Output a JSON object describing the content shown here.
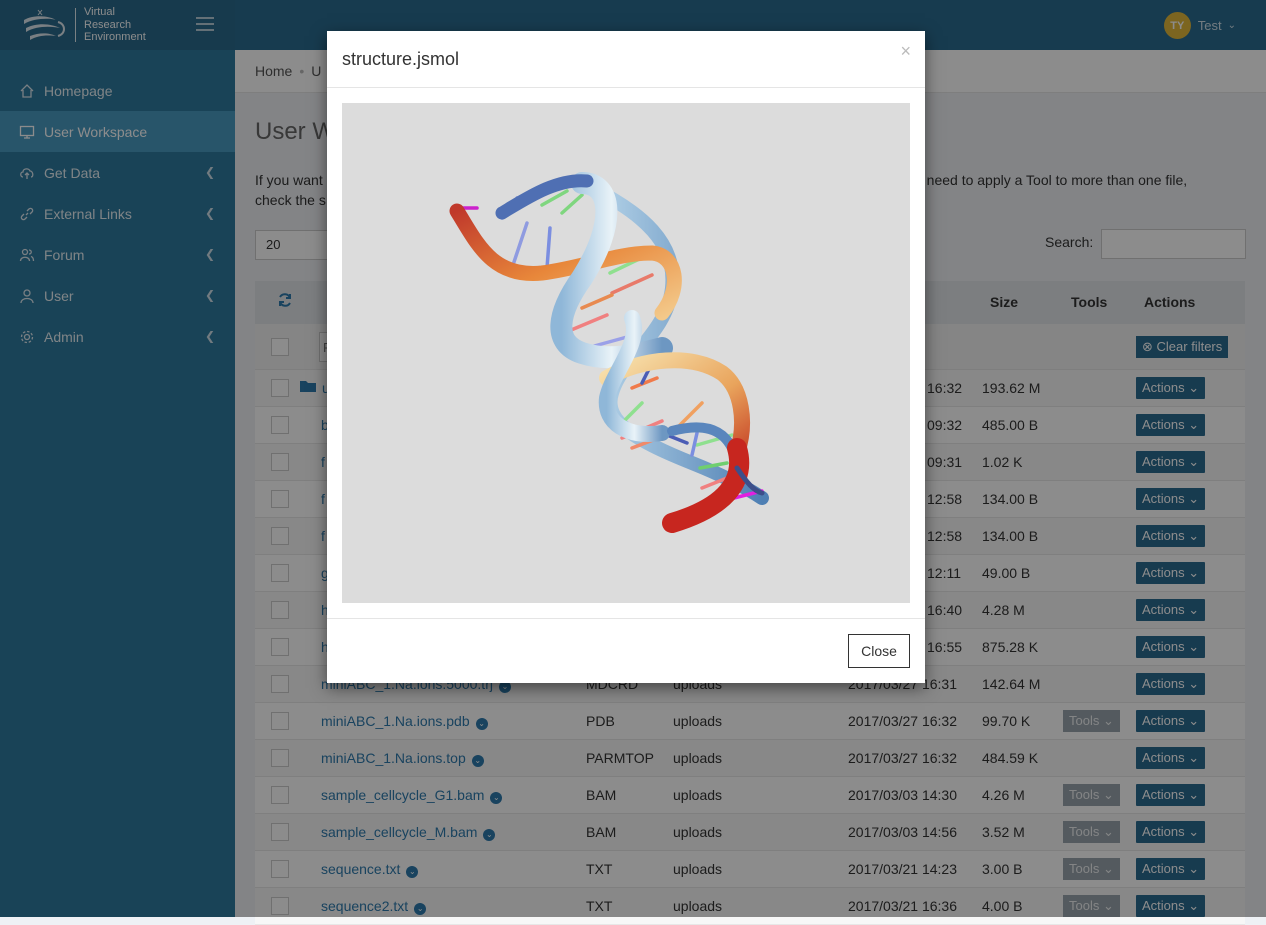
{
  "header": {
    "logo_lines": [
      "Virtual",
      "Research",
      "Environment"
    ],
    "user_initials": "TY",
    "user_name": "Test"
  },
  "sidebar": {
    "items": [
      {
        "label": "Homepage",
        "icon": "home-icon"
      },
      {
        "label": "User Workspace",
        "icon": "monitor-icon",
        "active": true
      },
      {
        "label": "Get Data",
        "icon": "cloud-upload-icon"
      },
      {
        "label": "External Links",
        "icon": "link-icon"
      },
      {
        "label": "Forum",
        "icon": "users-icon"
      },
      {
        "label": "User",
        "icon": "user-icon"
      },
      {
        "label": "Admin",
        "icon": "gear-icon"
      }
    ]
  },
  "breadcrumb": [
    "Home",
    "U"
  ],
  "page": {
    "title": "User W",
    "intro_left": "If you want",
    "intro_right": "u need to apply a Tool to more than one file,",
    "intro_line2": "check the s",
    "length_value": "20",
    "search_label": "Search:"
  },
  "table": {
    "headers": {
      "size": "Size",
      "tools": "Tools",
      "actions": "Actions"
    },
    "filter_input": "F",
    "clear_filters": "Clear filters",
    "actions_label": "Actions",
    "tools_label": "Tools",
    "rows": [
      {
        "name": "u",
        "type": "",
        "project": "",
        "date": "16:32",
        "size": "193.62 M",
        "folder": true,
        "tools": false
      },
      {
        "name": "b",
        "type": "",
        "project": "",
        "date": "09:32",
        "size": "485.00 B",
        "tools": false
      },
      {
        "name": "f",
        "type": "",
        "project": "",
        "date": "09:31",
        "size": "1.02 K",
        "tools": false
      },
      {
        "name": "f",
        "type": "",
        "project": "",
        "date": "12:58",
        "size": "134.00 B",
        "tools": false
      },
      {
        "name": "f",
        "type": "",
        "project": "",
        "date": "12:58",
        "size": "134.00 B",
        "tools": false
      },
      {
        "name": "g",
        "type": "",
        "project": "",
        "date": "12:11",
        "size": "49.00 B",
        "tools": false
      },
      {
        "name": "h",
        "type": "",
        "project": "",
        "date": "16:40",
        "size": "4.28 M",
        "tools": false
      },
      {
        "name": "h",
        "type": "",
        "project": "",
        "date": "16:55",
        "size": "875.28 K",
        "tools": false
      },
      {
        "name": "miniABC_1.Na.ions.5000.trj",
        "type": "MDCRD",
        "project": "uploads",
        "date": "2017/03/27 16:31",
        "size": "142.64 M",
        "tools": false
      },
      {
        "name": "miniABC_1.Na.ions.pdb",
        "type": "PDB",
        "project": "uploads",
        "date": "2017/03/27 16:32",
        "size": "99.70 K",
        "tools": true
      },
      {
        "name": "miniABC_1.Na.ions.top",
        "type": "PARMTOP",
        "project": "uploads",
        "date": "2017/03/27 16:32",
        "size": "484.59 K",
        "tools": false
      },
      {
        "name": "sample_cellcycle_G1.bam",
        "type": "BAM",
        "project": "uploads",
        "date": "2017/03/03 14:30",
        "size": "4.26 M",
        "tools": true
      },
      {
        "name": "sample_cellcycle_M.bam",
        "type": "BAM",
        "project": "uploads",
        "date": "2017/03/03 14:56",
        "size": "3.52 M",
        "tools": true
      },
      {
        "name": "sequence.txt",
        "type": "TXT",
        "project": "uploads",
        "date": "2017/03/21 14:23",
        "size": "3.00 B",
        "tools": true
      },
      {
        "name": "sequence2.txt",
        "type": "TXT",
        "project": "uploads",
        "date": "2017/03/21 16:36",
        "size": "4.00 B",
        "tools": true
      }
    ]
  },
  "modal": {
    "title": "structure.jsmol",
    "close_label": "Close",
    "x_label": "×"
  },
  "colors": {
    "header": "#2b6c90",
    "sidebar": "#2e7a9f",
    "sidebar_active": "#4a9bc2",
    "button": "#2b6c90",
    "avatar": "#e2b93b"
  }
}
